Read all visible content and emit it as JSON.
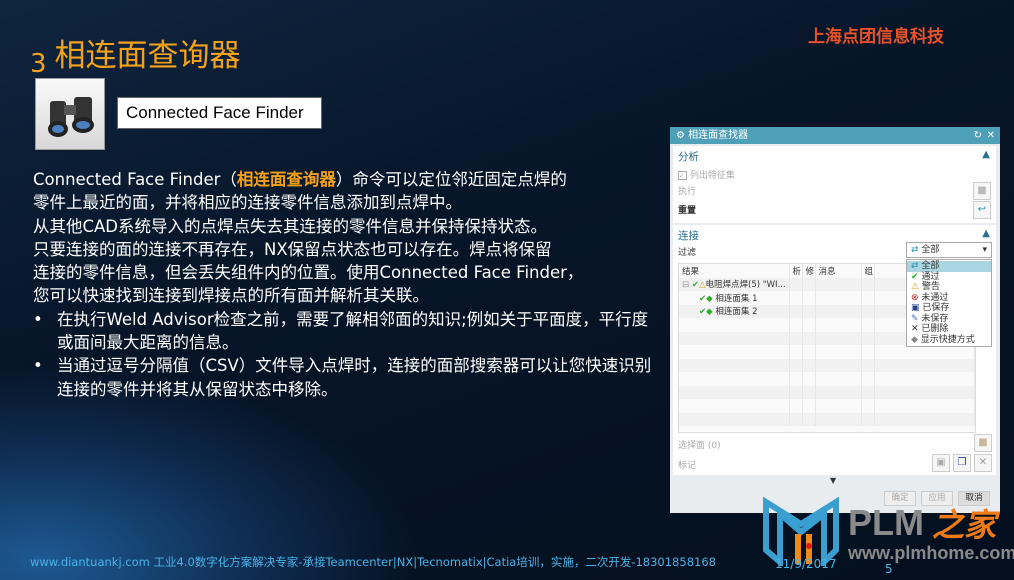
{
  "slide": {
    "number_prefix": "3",
    "title": "相连面查询器",
    "company": "上海点团信息科技",
    "tool_label": "Connected Face Finder",
    "body": {
      "p1_a": "Connected Face Finder（",
      "p1_hl": "相连面查询器",
      "p1_b": "）命令可以定位邻近固定点焊的",
      "p2": "零件上最近的面，并将相应的连接零件信息添加到点焊中。",
      "p3": "从其他CAD系统导入的点焊点失去其连接的零件信息并保持保持状态。",
      "p4": "只要连接的面的连接不再存在，NX保留点状态也可以存在。焊点将保留",
      "p5": "连接的零件信息，但会丢失组件内的位置。使用Connected Face Finder，",
      "p6": "您可以快速找到连接到焊接点的所有面并解析其关联。",
      "bullets": [
        "在执行Weld Advisor检查之前，需要了解相邻面的知识;例如关于平面度，平行度或面间最大距离的信息。",
        "当通过逗号分隔值（CSV）文件导入点焊时，连接的面部搜索器可以让您快速识别连接的零件并将其从保留状态中移除。"
      ]
    }
  },
  "dialog": {
    "title": "相连面查找器",
    "analysis": {
      "header": "分析",
      "list_feature_sets": "列出特征集",
      "execute": "执行",
      "reset": "重置"
    },
    "connection": {
      "header": "连接",
      "filter_label": "过滤",
      "filter_value": "全部",
      "columns": [
        "结果",
        "析",
        "修",
        "消息",
        "组"
      ],
      "rows": [
        "电阻焊点焊(5) \"WI...",
        "相连面集 1",
        "相连面集 2"
      ],
      "filter_options": [
        "全部",
        "通过",
        "警告",
        "未通过",
        "已保存",
        "未保存",
        "已删除",
        "显示快捷方式"
      ],
      "select_face": "选择面 (0)",
      "mark": "标记"
    },
    "buttons": {
      "ok": "确定",
      "apply": "应用",
      "cancel": "取消"
    }
  },
  "footer": {
    "text": "www.diantuankj.com 工业4.0数字化方案解决专家-承接Teamcenter|NX|Tecnomatix|Catia培训，实施，二次开发-18301858168",
    "date": "11/9/2017",
    "page": "5"
  },
  "logo": {
    "text": "PLM",
    "text_zh": "之家",
    "url": "www.plmhome.com"
  },
  "colors": {
    "accent": "#f6a11a",
    "company": "#e8522a",
    "dialog_title": "#4e9fb8",
    "footer": "#4ab3e8"
  }
}
